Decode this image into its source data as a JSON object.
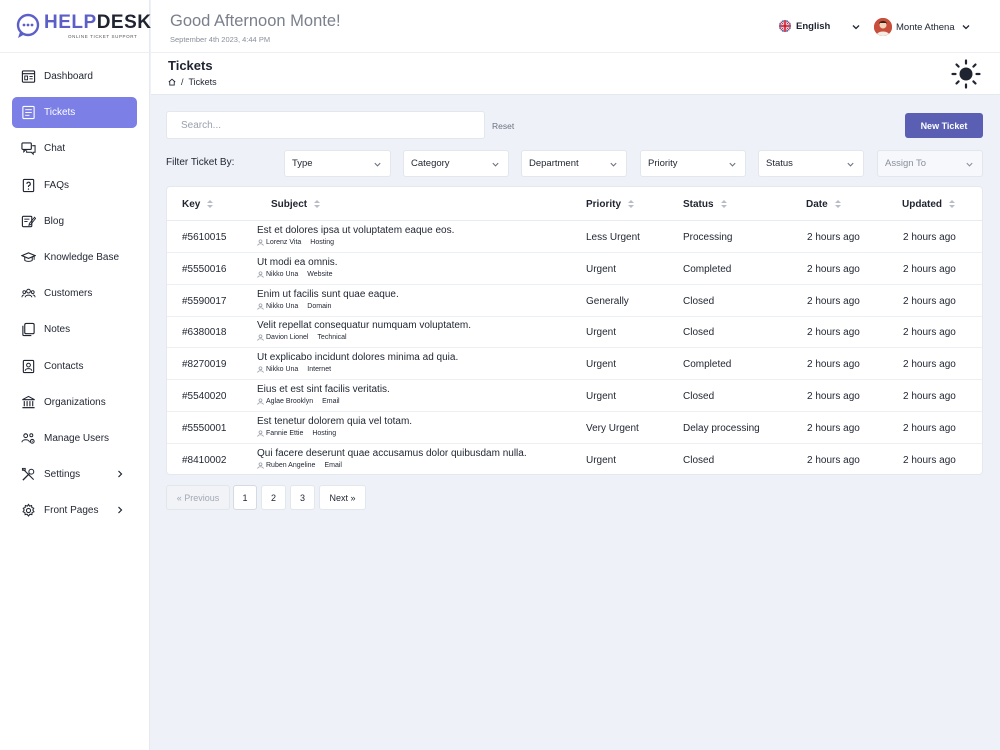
{
  "brand": {
    "name_a": "HELP",
    "name_b": "DESK",
    "tagline": "ONLINE TICKET SUPPORT"
  },
  "sidebar": {
    "items": [
      {
        "label": "Dashboard",
        "icon": "dashboard-icon",
        "active": false
      },
      {
        "label": "Tickets",
        "icon": "tickets-icon",
        "active": true
      },
      {
        "label": "Chat",
        "icon": "chat-icon",
        "active": false
      },
      {
        "label": "FAQs",
        "icon": "faq-icon",
        "active": false
      },
      {
        "label": "Blog",
        "icon": "blog-icon",
        "active": false
      },
      {
        "label": "Knowledge Base",
        "icon": "graduation-cap-icon",
        "active": false
      },
      {
        "label": "Customers",
        "icon": "customers-icon",
        "active": false
      },
      {
        "label": "Notes",
        "icon": "notes-icon",
        "active": false
      },
      {
        "label": "Contacts",
        "icon": "contacts-icon",
        "active": false
      },
      {
        "label": "Organizations",
        "icon": "organization-icon",
        "active": false
      },
      {
        "label": "Manage Users",
        "icon": "users-gear-icon",
        "active": false
      },
      {
        "label": "Settings",
        "icon": "tools-icon",
        "active": false
      },
      {
        "label": "Front Pages",
        "icon": "gear-icon",
        "active": false
      }
    ]
  },
  "topbar": {
    "greeting": "Good Afternoon Monte!",
    "date": "September 4th 2023, 4:44 PM",
    "language": "English",
    "user_name": "Monte Athena"
  },
  "header": {
    "title": "Tickets",
    "breadcrumb": "Tickets"
  },
  "search": {
    "placeholder": "Search...",
    "reset_label": "Reset"
  },
  "new_ticket_label": "New Ticket",
  "filters": {
    "label": "Filter Ticket By:",
    "items": [
      "Type",
      "Category",
      "Department",
      "Priority",
      "Status",
      "Assign To"
    ]
  },
  "table": {
    "columns": [
      "Key",
      "Subject",
      "Priority",
      "Status",
      "Date",
      "Updated"
    ],
    "rows": [
      {
        "key": "#5610015",
        "subject": "Est et dolores ipsa ut voluptatem eaque eos.",
        "user": "Lorenz Vita",
        "category": "Hosting",
        "priority": "Less Urgent",
        "status": "Processing",
        "date": "2 hours ago",
        "updated": "2 hours ago"
      },
      {
        "key": "#5550016",
        "subject": "Ut modi ea omnis.",
        "user": "Nikko Una",
        "category": "Website",
        "priority": "Urgent",
        "status": "Completed",
        "date": "2 hours ago",
        "updated": "2 hours ago"
      },
      {
        "key": "#5590017",
        "subject": "Enim ut facilis sunt quae eaque.",
        "user": "Nikko Una",
        "category": "Domain",
        "priority": "Generally",
        "status": "Closed",
        "date": "2 hours ago",
        "updated": "2 hours ago"
      },
      {
        "key": "#6380018",
        "subject": "Velit repellat consequatur numquam voluptatem.",
        "user": "Davion Lionel",
        "category": "Technical",
        "priority": "Urgent",
        "status": "Closed",
        "date": "2 hours ago",
        "updated": "2 hours ago"
      },
      {
        "key": "#8270019",
        "subject": "Ut explicabo incidunt dolores minima ad quia.",
        "user": "Nikko Una",
        "category": "Internet",
        "priority": "Urgent",
        "status": "Completed",
        "date": "2 hours ago",
        "updated": "2 hours ago"
      },
      {
        "key": "#5540020",
        "subject": "Eius et est sint facilis veritatis.",
        "user": "Aglae Brooklyn",
        "category": "Email",
        "priority": "Urgent",
        "status": "Closed",
        "date": "2 hours ago",
        "updated": "2 hours ago"
      },
      {
        "key": "#5550001",
        "subject": "Est tenetur dolorem quia vel totam.",
        "user": "Fannie Ettie",
        "category": "Hosting",
        "priority": "Very Urgent",
        "status": "Delay processing",
        "date": "2 hours ago",
        "updated": "2 hours ago"
      },
      {
        "key": "#8410002",
        "subject": "Qui facere deserunt quae accusamus dolor quibusdam nulla.",
        "user": "Ruben Angeline",
        "category": "Email",
        "priority": "Urgent",
        "status": "Closed",
        "date": "2 hours ago",
        "updated": "2 hours ago"
      }
    ]
  },
  "pagination": {
    "previous": "« Previous",
    "pages": [
      "1",
      "2",
      "3"
    ],
    "current": "1",
    "next": "Next »"
  },
  "colors": {
    "accent": "#7b7fe6",
    "button": "#5a5fb3",
    "background": "#eef2f8"
  }
}
